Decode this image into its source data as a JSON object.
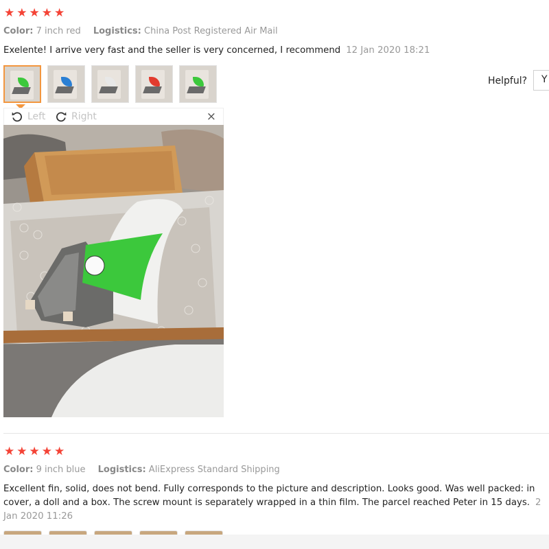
{
  "reviews": [
    {
      "rating": 5,
      "color_label": "Color:",
      "color_value": "7 inch red",
      "logistics_label": "Logistics:",
      "logistics_value": "China Post Registered Air Mail",
      "text": "Exelente! I arrive very fast and the seller is very concerned, I recommend",
      "date": "12 Jan 2020 18:21",
      "photos": [
        {
          "fin_color": "#3cc83c"
        },
        {
          "fin_color": "#2a7fd4"
        },
        {
          "fin_color": "#e8e8e8"
        },
        {
          "fin_color": "#e23b2e"
        },
        {
          "fin_color": "#3cc83c"
        }
      ],
      "viewer": {
        "rotate_left_label": "Left",
        "rotate_right_label": "Right",
        "close_glyph": "×"
      },
      "helpful": {
        "label": "Helpful?",
        "yes_label": "Y"
      }
    },
    {
      "rating": 5,
      "color_label": "Color:",
      "color_value": "9 inch blue",
      "logistics_label": "Logistics:",
      "logistics_value": "AliExpress Standard Shipping",
      "text_line1": "Excellent fin, solid, does not bend. Fully corresponds to the picture and description. Looks good. Was well packed: in",
      "text_line2": "cover, a doll and a box. The screw mount is separately wrapped in a thin film. The parcel reached Peter in 15 days.",
      "date_part1": "2",
      "date_part2": "Jan 2020 11:26"
    }
  ],
  "icons": {
    "star": "star-icon",
    "rotate_left": "rotate-left-icon",
    "rotate_right": "rotate-right-icon",
    "close": "close-icon"
  },
  "colors": {
    "star": "#f44336",
    "active_thumb_border": "#f3963e",
    "fin_green": "#3cc83c"
  }
}
